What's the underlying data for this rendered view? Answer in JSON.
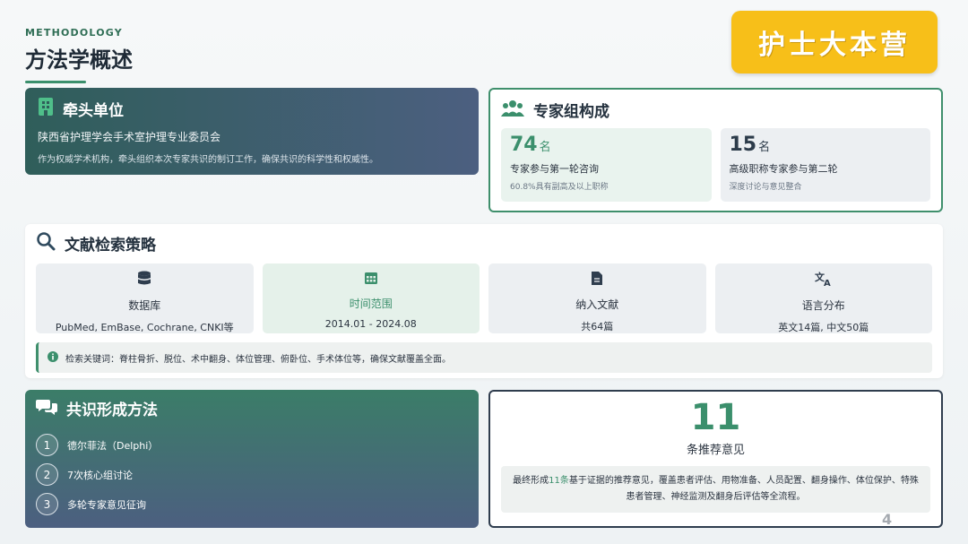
{
  "header": {
    "eyebrow": "METHODOLOGY",
    "title": "方法学概述"
  },
  "brand": {
    "label": "护士大本营",
    "color": "#f7bf19"
  },
  "lead_org": {
    "title": "牵头单位",
    "icon": "building-icon",
    "name": "陕西省护理学会手术室护理专业委员会",
    "description": "作为权威学术机构，牵头组织本次专家共识的制订工作，确保共识的科学性和权威性。"
  },
  "experts": {
    "title": "专家组构成",
    "icon": "users-icon",
    "stats": [
      {
        "number": "74",
        "unit": "名",
        "desc": "专家参与第一轮咨询",
        "note": "60.8%具有副高及以上职称"
      },
      {
        "number": "15",
        "unit": "名",
        "desc": "高级职称专家参与第二轮",
        "note": "深度讨论与意见整合"
      }
    ]
  },
  "search": {
    "title": "文献检索策略",
    "icon": "search-icon",
    "tiles": [
      {
        "icon": "database-icon",
        "label": "数据库",
        "value": "PubMed, EmBase, Cochrane, CNKI等"
      },
      {
        "icon": "calendar-icon",
        "label": "时间范围",
        "value": "2014.01 - 2024.08"
      },
      {
        "icon": "document-icon",
        "label": "纳入文献",
        "value": "共64篇"
      },
      {
        "icon": "translate-icon",
        "label": "语言分布",
        "value": "英文14篇, 中文50篇"
      }
    ],
    "keywords": "检索关键词：脊柱骨折、脱位、术中翻身、体位管理、俯卧位、手术体位等，确保文献覆盖全面。"
  },
  "method": {
    "title": "共识形成方法",
    "icon": "chat-icon",
    "steps": [
      {
        "num": "1",
        "text": "德尔菲法（Delphi）"
      },
      {
        "num": "2",
        "text": "7次核心组讨论"
      },
      {
        "num": "3",
        "text": "多轮专家意见征询"
      }
    ]
  },
  "result": {
    "number": "11",
    "label": "条推荐意见",
    "desc_pre": "最终形成",
    "desc_accent": "11条",
    "desc_post": "基于证据的推荐意见，覆盖患者评估、用物准备、人员配置、翻身操作、体位保护、特殊患者管理、神经监测及翻身后评估等全流程。"
  },
  "page_number": "4",
  "colors": {
    "accent": "#3b8f6c",
    "dark": "#2f3d4e"
  }
}
